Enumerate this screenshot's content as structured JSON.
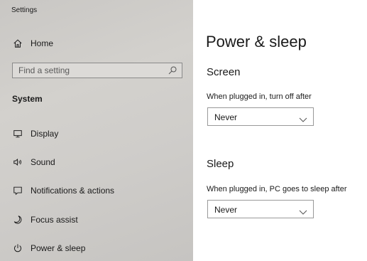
{
  "window": {
    "title": "Settings"
  },
  "sidebar": {
    "home_label": "Home",
    "search": {
      "placeholder": "Find a setting"
    },
    "section_label": "System",
    "items": [
      {
        "label": "Display",
        "icon": "monitor-icon"
      },
      {
        "label": "Sound",
        "icon": "speaker-icon"
      },
      {
        "label": "Notifications & actions",
        "icon": "notification-icon"
      },
      {
        "label": "Focus assist",
        "icon": "moon-icon"
      },
      {
        "label": "Power & sleep",
        "icon": "power-icon",
        "selected": true
      }
    ]
  },
  "main": {
    "title": "Power & sleep",
    "screen": {
      "heading": "Screen",
      "label": "When plugged in, turn off after",
      "value": "Never"
    },
    "sleep": {
      "heading": "Sleep",
      "label": "When plugged in, PC goes to sleep after",
      "value": "Never"
    }
  },
  "colors": {
    "sidebar_bg": "#cfcdca",
    "page_bg": "#ffffff",
    "text": "#1a1a1a",
    "border": "#999999"
  }
}
